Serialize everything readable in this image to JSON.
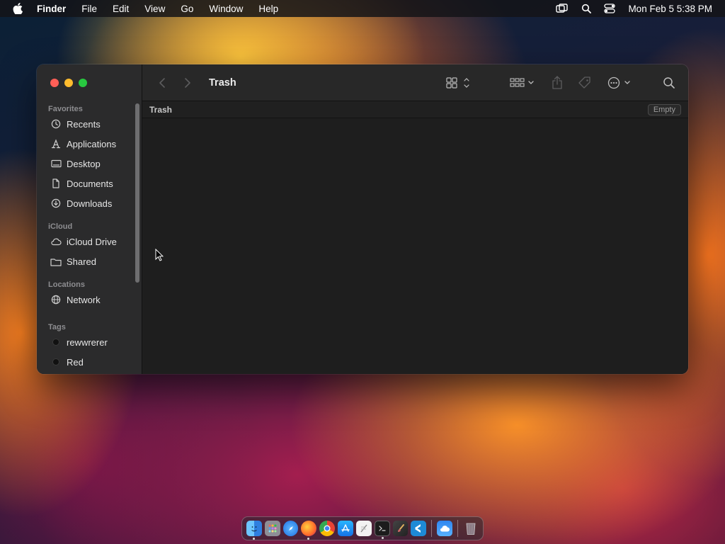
{
  "menubar": {
    "app_name": "Finder",
    "items": [
      "File",
      "Edit",
      "View",
      "Go",
      "Window",
      "Help"
    ],
    "clock": "Mon Feb 5  5:38 PM",
    "icons": [
      "apple-logo-icon",
      "screen-mirroring-icon",
      "spotlight-search-icon",
      "control-center-icon"
    ]
  },
  "window": {
    "title": "Trash",
    "path_label": "Trash",
    "empty_button": "Empty"
  },
  "sidebar": {
    "sections": [
      {
        "title": "Favorites",
        "items": [
          {
            "label": "Recents",
            "icon": "clock-icon"
          },
          {
            "label": "Applications",
            "icon": "applications-icon"
          },
          {
            "label": "Desktop",
            "icon": "desktop-icon"
          },
          {
            "label": "Documents",
            "icon": "document-icon"
          },
          {
            "label": "Downloads",
            "icon": "download-icon"
          }
        ]
      },
      {
        "title": "iCloud",
        "items": [
          {
            "label": "iCloud Drive",
            "icon": "cloud-icon"
          },
          {
            "label": "Shared",
            "icon": "shared-folder-icon"
          }
        ]
      },
      {
        "title": "Locations",
        "items": [
          {
            "label": "Network",
            "icon": "globe-icon"
          }
        ]
      },
      {
        "title": "Tags",
        "items": [
          {
            "label": "rewwrerer",
            "icon": "tag-dot-icon"
          },
          {
            "label": "Red",
            "icon": "tag-dot-icon"
          }
        ]
      }
    ]
  },
  "toolbar": {
    "icons": [
      "back-icon",
      "forward-icon",
      "icon-view-icon",
      "group-icon",
      "share-icon",
      "tag-icon",
      "more-actions-icon",
      "search-icon"
    ]
  },
  "dock": {
    "apps": [
      "finder-icon",
      "launchpad-icon",
      "safari-icon",
      "firefox-icon",
      "chrome-icon",
      "app-store-icon",
      "textedit-icon",
      "terminal-icon",
      "paintbrush-icon",
      "vscode-icon",
      "weather-icon",
      "trash-icon"
    ]
  },
  "colors": {
    "close": "#ff5f57",
    "minimize": "#febc2e",
    "maximize": "#28c840",
    "sidebar_bg": "#2b2b2c",
    "content_bg": "#1e1e1e"
  }
}
